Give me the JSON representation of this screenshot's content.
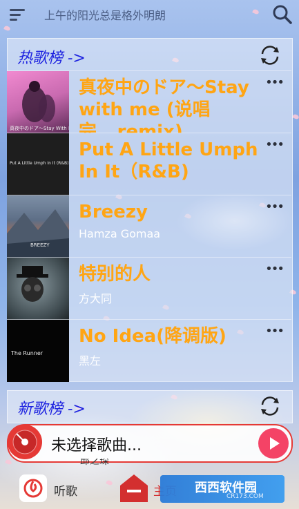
{
  "header": {
    "tagline": "上午的阳光总是格外明朗",
    "menu_icon": "menu-icon",
    "search_icon": "search-icon"
  },
  "hot_section": {
    "title": "热歌榜 ->",
    "refresh_icon": "refresh-icon",
    "songs": [
      {
        "title": "真夜中のドア～Stay with me (说唱完...remix)",
        "artist": "",
        "cover_text": "真夜中のドア～Stay With M"
      },
      {
        "title": "Put A Little Umph In It（R&B)",
        "artist": "",
        "cover_text": "Put A Little Umph In It (R&B)"
      },
      {
        "title": "Breezy",
        "artist": "Hamza Gomaa",
        "cover_text": "BREEZY"
      },
      {
        "title": "特别的人",
        "artist": "方大同",
        "cover_text": ""
      },
      {
        "title": "No Idea(降调版)",
        "artist": "黑左",
        "cover_text": "The Runner"
      }
    ],
    "more_label": "•••"
  },
  "new_section": {
    "title": "新歌榜 ->",
    "refresh_icon": "refresh-icon"
  },
  "player": {
    "now_playing": "未选择歌曲...",
    "partial_text": "邱之琛",
    "disc_icon": "vinyl-disc-icon",
    "play_icon": "play-icon"
  },
  "bottom_nav": {
    "listen_label": "听歌",
    "home_label": "主页",
    "watermark_text": "西西软件园",
    "watermark_sub": "CR173.COM"
  },
  "colors": {
    "accent_title": "#ffa514",
    "section_title": "#1d22e0",
    "player_red": "#e53935",
    "play_pink": "#f44366"
  }
}
